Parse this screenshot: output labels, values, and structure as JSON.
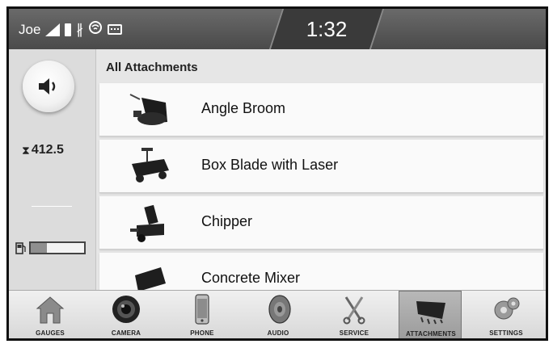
{
  "status_bar": {
    "user": "Joe",
    "time": "1:32",
    "icons": [
      "signal-icon",
      "battery-icon",
      "bluetooth-icon",
      "wifi-icon",
      "keyboard-icon"
    ]
  },
  "side_panel": {
    "volume_icon": "speaker-icon",
    "hour_meter": "412.5",
    "fuel_level": 0.3
  },
  "main": {
    "section_title": "All Attachments",
    "attachments": [
      {
        "label": "Angle Broom",
        "icon": "angle-broom-icon"
      },
      {
        "label": "Box Blade with Laser",
        "icon": "box-blade-icon"
      },
      {
        "label": "Chipper",
        "icon": "chipper-icon"
      },
      {
        "label": "Concrete Mixer",
        "icon": "concrete-mixer-icon"
      }
    ]
  },
  "bottom_nav": {
    "items": [
      {
        "label": "GAUGES",
        "icon": "house-icon"
      },
      {
        "label": "CAMERA",
        "icon": "camera-lens-icon"
      },
      {
        "label": "PHONE",
        "icon": "phone-icon"
      },
      {
        "label": "AUDIO",
        "icon": "speaker-cone-icon"
      },
      {
        "label": "SERVICE",
        "icon": "tools-icon"
      },
      {
        "label": "ATTACHMENTS",
        "icon": "bucket-icon"
      },
      {
        "label": "SETTINGS",
        "icon": "gear-icon"
      }
    ],
    "active": "ATTACHMENTS"
  },
  "colors": {
    "status_bar": "#555555",
    "panel": "#dcdcdc",
    "active_tab": "#a8a8a8"
  }
}
